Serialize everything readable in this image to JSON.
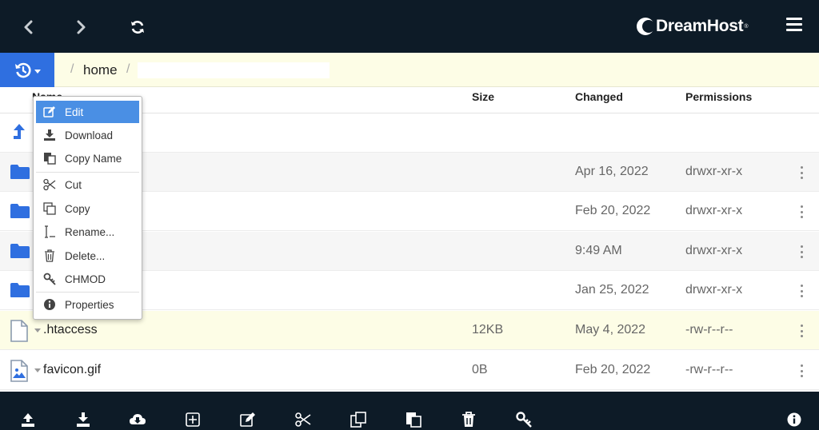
{
  "brand": {
    "name": "DreamHost",
    "tm": "®"
  },
  "colors": {
    "topbar": "#0d1b27",
    "accent": "#2f6fe0",
    "menu_active": "#4a8fe4",
    "path_bg": "#fdfde6"
  },
  "toolbar_top": {
    "icons": [
      "chevron-left-icon",
      "chevron-right-icon",
      "refresh-icon",
      "hamburger-menu-icon"
    ]
  },
  "breadcrumb": {
    "items": [
      "home"
    ],
    "input_value": ""
  },
  "columns": {
    "name": "Name",
    "size": "Size",
    "changed": "Changed",
    "permissions": "Permissions"
  },
  "rows": [
    {
      "type": "parent",
      "name": "",
      "size": "",
      "changed": "",
      "permissions": ""
    },
    {
      "type": "folder",
      "name": "",
      "size": "",
      "changed": "Apr 16, 2022",
      "permissions": "drwxr-xr-x"
    },
    {
      "type": "folder",
      "name": "",
      "size": "",
      "changed": "Feb 20, 2022",
      "permissions": "drwxr-xr-x"
    },
    {
      "type": "folder",
      "name": "",
      "size": "",
      "changed": "9:49 AM",
      "permissions": "drwxr-xr-x"
    },
    {
      "type": "folder",
      "name": "",
      "size": "",
      "changed": "Jan 25, 2022",
      "permissions": "drwxr-xr-x"
    },
    {
      "type": "file",
      "name": ".htaccess",
      "size": "12KB",
      "changed": "May 4, 2022",
      "permissions": "-rw-r--r--"
    },
    {
      "type": "image",
      "name": "favicon.gif",
      "size": "0B",
      "changed": "Feb 20, 2022",
      "permissions": "-rw-r--r--"
    }
  ],
  "context_menu": {
    "items": [
      {
        "label": "Edit",
        "icon": "edit-icon"
      },
      {
        "label": "Download",
        "icon": "download-icon"
      },
      {
        "label": "Copy Name",
        "icon": "copy-name-icon"
      },
      {
        "label": "Cut",
        "icon": "scissors-icon"
      },
      {
        "label": "Copy",
        "icon": "copy-icon"
      },
      {
        "label": "Rename...",
        "icon": "rename-icon"
      },
      {
        "label": "Delete...",
        "icon": "trash-icon"
      },
      {
        "label": "CHMOD",
        "icon": "key-icon"
      },
      {
        "label": "Properties",
        "icon": "info-icon"
      }
    ]
  },
  "toolbar_bottom": {
    "icons": [
      "upload-icon",
      "download-icon",
      "cloud-download-icon",
      "new-file-icon",
      "edit-icon",
      "scissors-icon",
      "copy-icon",
      "paste-icon",
      "trash-icon",
      "key-icon",
      "info-icon"
    ]
  }
}
